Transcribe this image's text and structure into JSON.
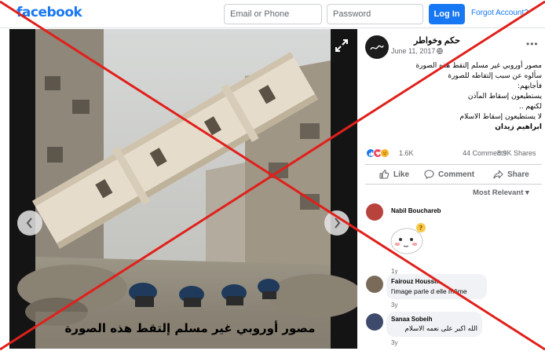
{
  "header": {
    "logo": "facebook",
    "email_placeholder": "Email or Phone",
    "password_placeholder": "Password",
    "login_label": "Log In",
    "forgot_label": "Forgot Account?"
  },
  "photo": {
    "caption": "مصور أوروبي غير مسلم إلتقط هذه الصورة"
  },
  "post": {
    "page_name": "حكم وخواطر",
    "date": "June 11, 2017 ·",
    "lines": [
      "مصور أوروبي غير مسلم إلتقط هذه الصورة",
      "سألوه عن سبب إلتقاطه للصورة",
      "فأجابهم:",
      "يستطيعون إسقاط المآذن",
      "لكنهم ..",
      "لا يستطيعون إسقاط الاسلام"
    ],
    "author": "ابراهيم زيدان",
    "reaction_count": "1.6K",
    "comment_count": "44 Comments",
    "share_count": "8.9K Shares",
    "actions": {
      "like": "Like",
      "comment": "Comment",
      "share": "Share"
    },
    "sort_label": "Most Relevant"
  },
  "comments": [
    {
      "name": "Nabil Bouchareb",
      "text": "",
      "time": "1y"
    },
    {
      "name": "Fairouz Houssm",
      "text": "l'image parle d elle même",
      "time": "3y"
    },
    {
      "name": "Sanaa Sobeih",
      "text": "الله اكبر على نعمه الاسلام",
      "time": "3y"
    }
  ],
  "colors": {
    "brand": "#1877f2",
    "cross": "#e0201b",
    "like": "#1877f2",
    "love": "#f33e58"
  },
  "icons": [
    "expand-icon",
    "chevron-left-icon",
    "chevron-right-icon",
    "globe-icon",
    "more-dots-icon",
    "like-icon",
    "comment-icon",
    "share-icon",
    "caret-down-icon",
    "sticker-icon"
  ]
}
